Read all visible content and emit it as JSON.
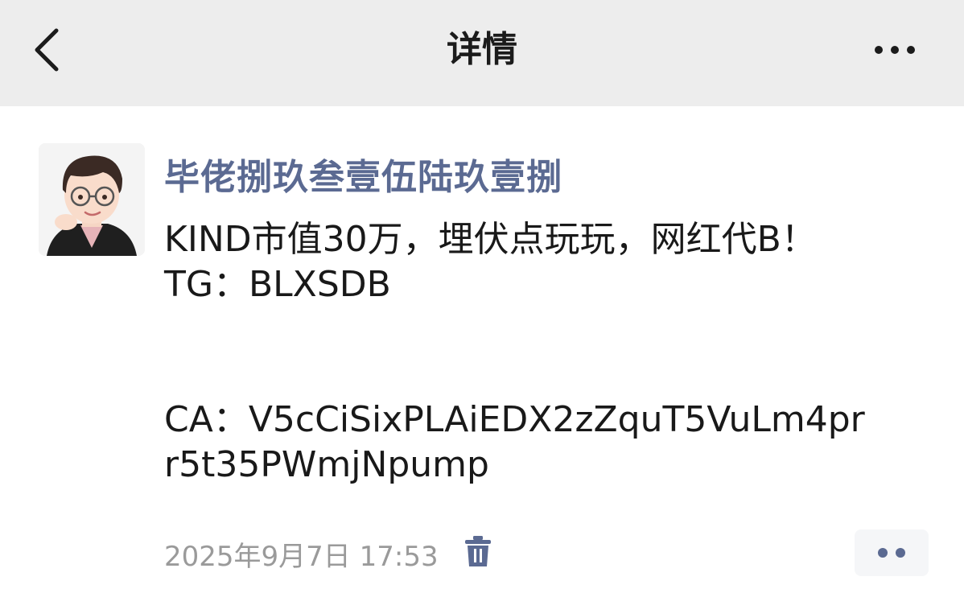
{
  "nav": {
    "title": "详情",
    "back_icon": "chevron-left-icon",
    "more_icon": "more-horizontal-icon"
  },
  "post": {
    "author_name": "毕佬捌玖叁壹伍陆玖壹捌",
    "avatar_icon": "cartoon-avatar",
    "lines": [
      "KIND市值30万，埋伏点玩玩，网红代B！",
      "TG：BLXSDB",
      "CA：V5cCiSixPLAiEDX2zZquT5VuLm4pr",
      "r5t35PWmjNpump"
    ],
    "timestamp": "2025年9月7日 17:53",
    "delete_icon": "trash-icon",
    "comment_icon": "two-dots-icon"
  },
  "colors": {
    "nav_bg": "#ededed",
    "author_name": "#5b6a92",
    "text": "#191919",
    "timestamp": "#9a9a9a",
    "trash": "#5b6a92"
  }
}
